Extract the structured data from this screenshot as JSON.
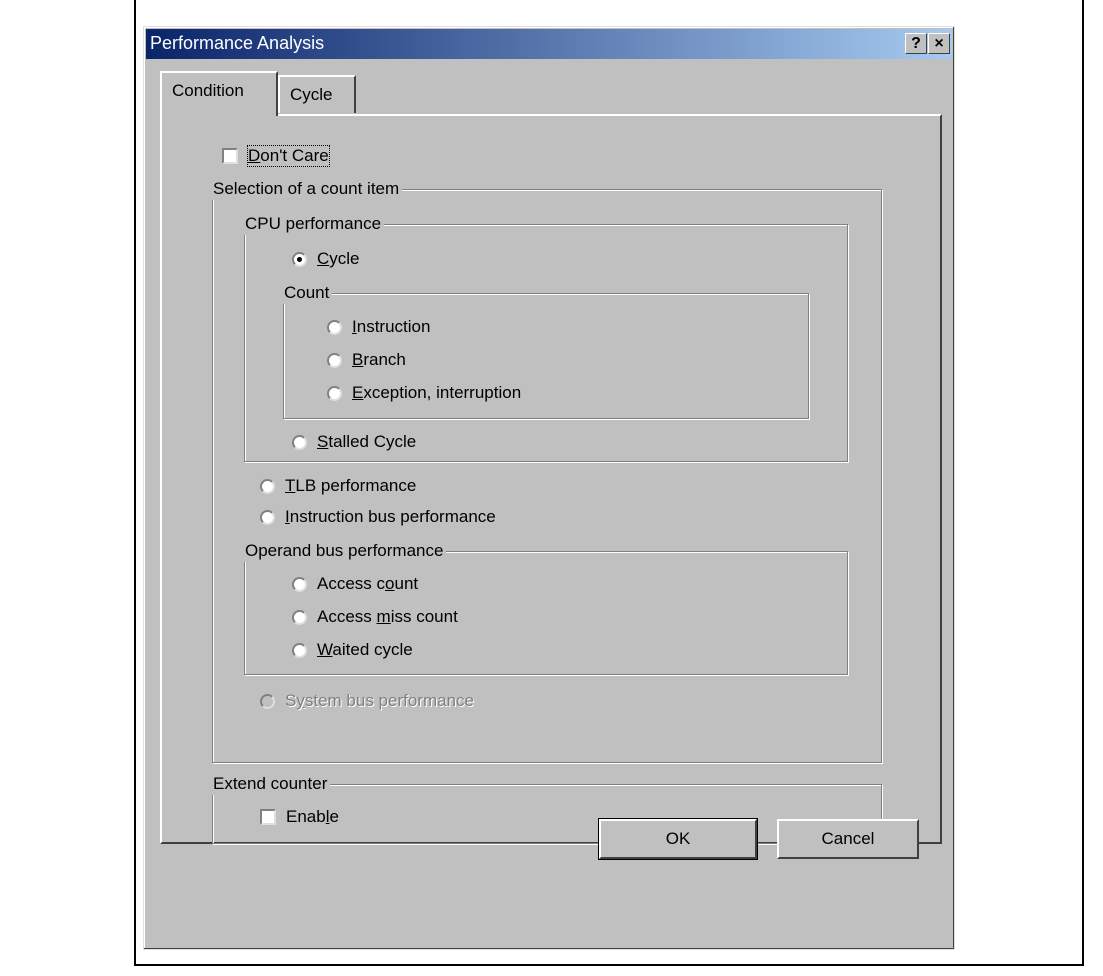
{
  "window": {
    "title": "Performance Analysis",
    "help_label": "?",
    "close_label": "×"
  },
  "tabs": [
    {
      "label": "Condition",
      "active": true
    },
    {
      "label": "Cycle",
      "active": false
    }
  ],
  "dont_care": {
    "pre": "",
    "key": "D",
    "post": "on't Care",
    "checked": false
  },
  "count_item_group": {
    "label": "Selection of a count item"
  },
  "cpu_group": {
    "label": "CPU performance"
  },
  "cycle_radio": {
    "pre": "",
    "key": "C",
    "post": "ycle",
    "checked": true
  },
  "count_group": {
    "label": "Count"
  },
  "instruction_radio": {
    "pre": "",
    "key": "I",
    "post": "nstruction"
  },
  "branch_radio": {
    "pre": "",
    "key": "B",
    "post": "ranch"
  },
  "exception_radio": {
    "pre": "",
    "key": "E",
    "post": "xception, interruption"
  },
  "stalled_radio": {
    "pre": "",
    "key": "S",
    "post": "talled Cycle"
  },
  "tlb_radio": {
    "pre": "",
    "key": "T",
    "post": "LB performance"
  },
  "ibus_radio": {
    "pre": "",
    "key": "I",
    "post": "nstruction bus performance"
  },
  "operand_group": {
    "label": "Operand bus performance"
  },
  "access_count_radio": {
    "pre": "Access c",
    "key": "o",
    "post": "unt"
  },
  "access_miss_radio": {
    "pre": "Access ",
    "key": "m",
    "post": "iss count"
  },
  "waited_radio": {
    "pre": "",
    "key": "W",
    "post": "aited cycle"
  },
  "system_bus_radio": {
    "pre": "S",
    "key": "y",
    "post": "stem bus performance",
    "disabled": true
  },
  "extend_group": {
    "label": "Extend counter"
  },
  "enable_check": {
    "pre": "Enab",
    "key": "l",
    "post": "e",
    "checked": false
  },
  "buttons": {
    "ok": "OK",
    "cancel": "Cancel"
  }
}
